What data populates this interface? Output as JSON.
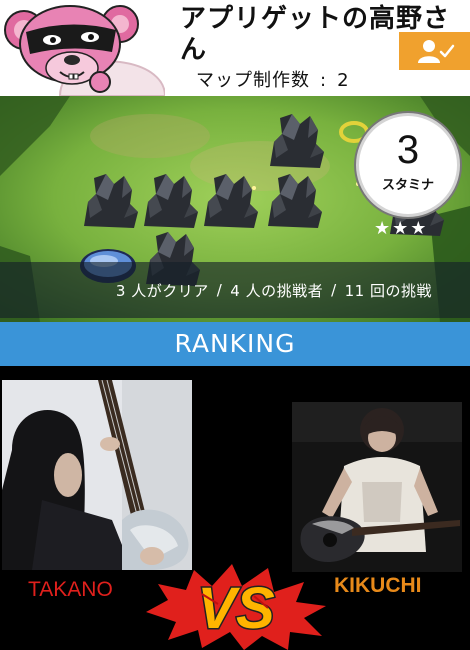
{
  "header": {
    "title": "アプリゲットの高野さん",
    "map_count_label": "マップ制作数",
    "map_count_value": "2",
    "follow_icon": "person-check-icon",
    "follow_color": "#f0a12e"
  },
  "map_panel": {
    "stamina_value": "3",
    "stamina_label": "スタミナ",
    "stars": "★★★",
    "stats": {
      "cleared": "3 人がクリア",
      "challengers": "4 人の挑戦者",
      "attempts": "11 回の挑戦"
    }
  },
  "ranking": {
    "label": "RANKING",
    "color": "#3a94d8"
  },
  "battle": {
    "left_name": "TAKANO",
    "right_name": "KIKUCHI",
    "vs_text": "VS",
    "left_name_color": "#e0201c",
    "right_name_color": "#e88a1a"
  }
}
